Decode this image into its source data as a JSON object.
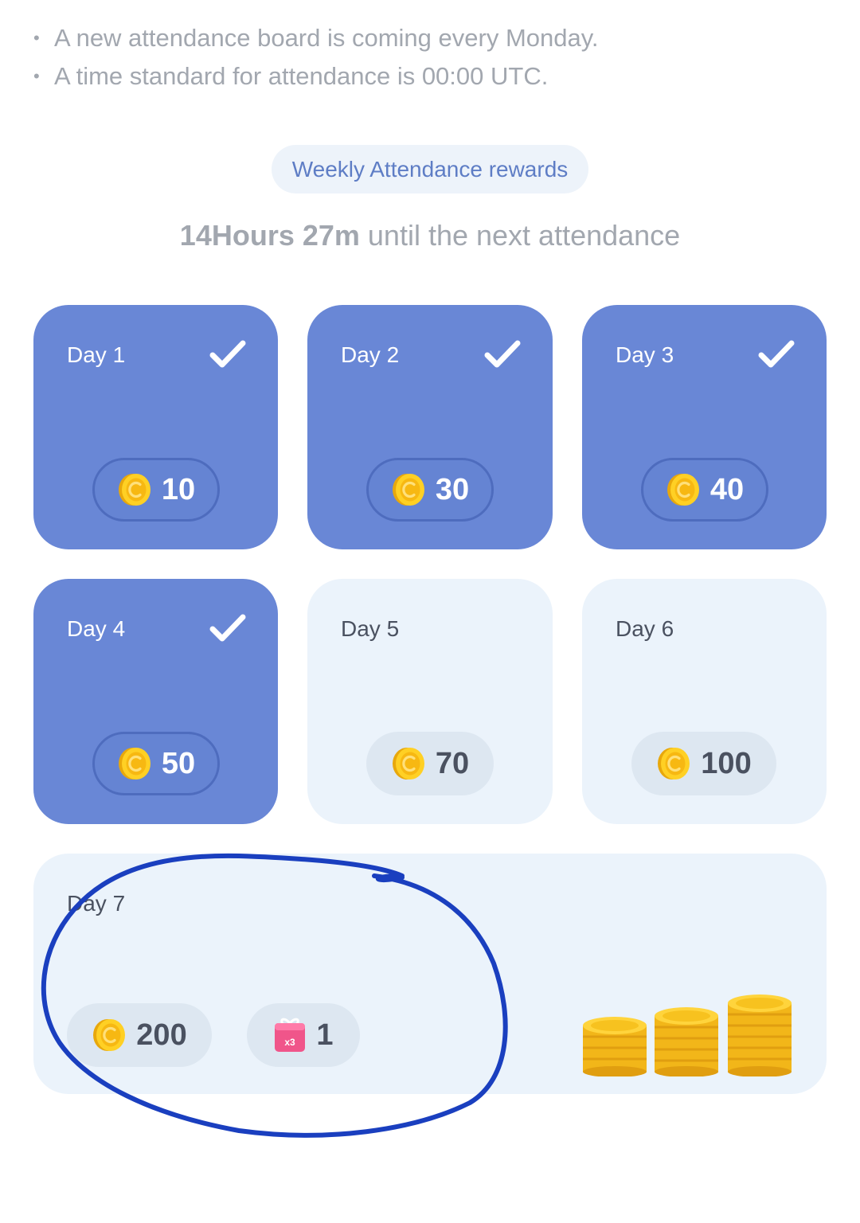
{
  "notes": [
    "A new attendance board is coming every Monday.",
    "A time standard for attendance is 00:00 UTC."
  ],
  "header": {
    "title": "Weekly Attendance rewards"
  },
  "countdown": {
    "time": "14Hours 27m",
    "suffix": " until the next attendance"
  },
  "days": [
    {
      "label": "Day 1",
      "reward": "10",
      "claimed": true
    },
    {
      "label": "Day 2",
      "reward": "30",
      "claimed": true
    },
    {
      "label": "Day 3",
      "reward": "40",
      "claimed": true
    },
    {
      "label": "Day 4",
      "reward": "50",
      "claimed": true
    },
    {
      "label": "Day 5",
      "reward": "70",
      "claimed": false
    },
    {
      "label": "Day 6",
      "reward": "100",
      "claimed": false
    }
  ],
  "day7": {
    "label": "Day 7",
    "coin_reward": "200",
    "ticket_reward": "1",
    "ticket_badge": "x3",
    "claimed": false
  },
  "colors": {
    "claimed_card": "#6987d6",
    "unclaimed_card": "#ebf3fb",
    "accent_text": "#5e7dc5",
    "annotation_stroke": "#1a3fbf"
  },
  "icons": {
    "bullet": "•",
    "claimed": "check-icon",
    "currency": "coin-icon",
    "ticket": "gift-box-icon",
    "decoration": "coin-stacks-icon"
  }
}
